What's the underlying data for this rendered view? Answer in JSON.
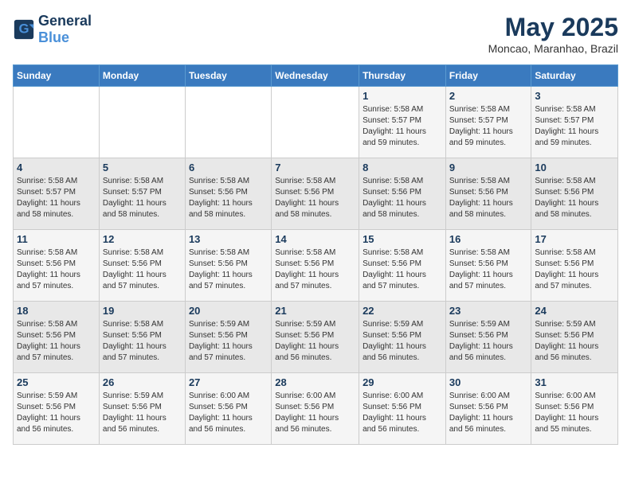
{
  "header": {
    "logo_general": "General",
    "logo_blue": "Blue",
    "month_year": "May 2025",
    "location": "Moncao, Maranhao, Brazil"
  },
  "days_of_week": [
    "Sunday",
    "Monday",
    "Tuesday",
    "Wednesday",
    "Thursday",
    "Friday",
    "Saturday"
  ],
  "weeks": [
    [
      {
        "day": "",
        "info": ""
      },
      {
        "day": "",
        "info": ""
      },
      {
        "day": "",
        "info": ""
      },
      {
        "day": "",
        "info": ""
      },
      {
        "day": "1",
        "info": "Sunrise: 5:58 AM\nSunset: 5:57 PM\nDaylight: 11 hours\nand 59 minutes."
      },
      {
        "day": "2",
        "info": "Sunrise: 5:58 AM\nSunset: 5:57 PM\nDaylight: 11 hours\nand 59 minutes."
      },
      {
        "day": "3",
        "info": "Sunrise: 5:58 AM\nSunset: 5:57 PM\nDaylight: 11 hours\nand 59 minutes."
      }
    ],
    [
      {
        "day": "4",
        "info": "Sunrise: 5:58 AM\nSunset: 5:57 PM\nDaylight: 11 hours\nand 58 minutes."
      },
      {
        "day": "5",
        "info": "Sunrise: 5:58 AM\nSunset: 5:57 PM\nDaylight: 11 hours\nand 58 minutes."
      },
      {
        "day": "6",
        "info": "Sunrise: 5:58 AM\nSunset: 5:56 PM\nDaylight: 11 hours\nand 58 minutes."
      },
      {
        "day": "7",
        "info": "Sunrise: 5:58 AM\nSunset: 5:56 PM\nDaylight: 11 hours\nand 58 minutes."
      },
      {
        "day": "8",
        "info": "Sunrise: 5:58 AM\nSunset: 5:56 PM\nDaylight: 11 hours\nand 58 minutes."
      },
      {
        "day": "9",
        "info": "Sunrise: 5:58 AM\nSunset: 5:56 PM\nDaylight: 11 hours\nand 58 minutes."
      },
      {
        "day": "10",
        "info": "Sunrise: 5:58 AM\nSunset: 5:56 PM\nDaylight: 11 hours\nand 58 minutes."
      }
    ],
    [
      {
        "day": "11",
        "info": "Sunrise: 5:58 AM\nSunset: 5:56 PM\nDaylight: 11 hours\nand 57 minutes."
      },
      {
        "day": "12",
        "info": "Sunrise: 5:58 AM\nSunset: 5:56 PM\nDaylight: 11 hours\nand 57 minutes."
      },
      {
        "day": "13",
        "info": "Sunrise: 5:58 AM\nSunset: 5:56 PM\nDaylight: 11 hours\nand 57 minutes."
      },
      {
        "day": "14",
        "info": "Sunrise: 5:58 AM\nSunset: 5:56 PM\nDaylight: 11 hours\nand 57 minutes."
      },
      {
        "day": "15",
        "info": "Sunrise: 5:58 AM\nSunset: 5:56 PM\nDaylight: 11 hours\nand 57 minutes."
      },
      {
        "day": "16",
        "info": "Sunrise: 5:58 AM\nSunset: 5:56 PM\nDaylight: 11 hours\nand 57 minutes."
      },
      {
        "day": "17",
        "info": "Sunrise: 5:58 AM\nSunset: 5:56 PM\nDaylight: 11 hours\nand 57 minutes."
      }
    ],
    [
      {
        "day": "18",
        "info": "Sunrise: 5:58 AM\nSunset: 5:56 PM\nDaylight: 11 hours\nand 57 minutes."
      },
      {
        "day": "19",
        "info": "Sunrise: 5:58 AM\nSunset: 5:56 PM\nDaylight: 11 hours\nand 57 minutes."
      },
      {
        "day": "20",
        "info": "Sunrise: 5:59 AM\nSunset: 5:56 PM\nDaylight: 11 hours\nand 57 minutes."
      },
      {
        "day": "21",
        "info": "Sunrise: 5:59 AM\nSunset: 5:56 PM\nDaylight: 11 hours\nand 56 minutes."
      },
      {
        "day": "22",
        "info": "Sunrise: 5:59 AM\nSunset: 5:56 PM\nDaylight: 11 hours\nand 56 minutes."
      },
      {
        "day": "23",
        "info": "Sunrise: 5:59 AM\nSunset: 5:56 PM\nDaylight: 11 hours\nand 56 minutes."
      },
      {
        "day": "24",
        "info": "Sunrise: 5:59 AM\nSunset: 5:56 PM\nDaylight: 11 hours\nand 56 minutes."
      }
    ],
    [
      {
        "day": "25",
        "info": "Sunrise: 5:59 AM\nSunset: 5:56 PM\nDaylight: 11 hours\nand 56 minutes."
      },
      {
        "day": "26",
        "info": "Sunrise: 5:59 AM\nSunset: 5:56 PM\nDaylight: 11 hours\nand 56 minutes."
      },
      {
        "day": "27",
        "info": "Sunrise: 6:00 AM\nSunset: 5:56 PM\nDaylight: 11 hours\nand 56 minutes."
      },
      {
        "day": "28",
        "info": "Sunrise: 6:00 AM\nSunset: 5:56 PM\nDaylight: 11 hours\nand 56 minutes."
      },
      {
        "day": "29",
        "info": "Sunrise: 6:00 AM\nSunset: 5:56 PM\nDaylight: 11 hours\nand 56 minutes."
      },
      {
        "day": "30",
        "info": "Sunrise: 6:00 AM\nSunset: 5:56 PM\nDaylight: 11 hours\nand 56 minutes."
      },
      {
        "day": "31",
        "info": "Sunrise: 6:00 AM\nSunset: 5:56 PM\nDaylight: 11 hours\nand 55 minutes."
      }
    ]
  ]
}
